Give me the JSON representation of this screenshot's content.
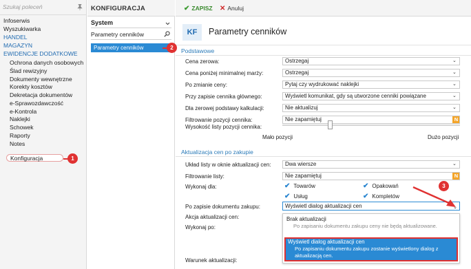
{
  "nav": {
    "search_placeholder": "Szukaj poleceń",
    "items": [
      {
        "label": "Infoserwis"
      },
      {
        "label": "Wyszukiwarka"
      },
      {
        "label": "HANDEL"
      },
      {
        "label": "MAGAZYN"
      },
      {
        "label": "EWIDENCJE DODATKOWE"
      },
      {
        "label": "Ochrona danych osobowych"
      },
      {
        "label": "Ślad rewizyjny"
      },
      {
        "label": "Dokumenty wewnętrzne"
      },
      {
        "label": "Korekty kosztów"
      },
      {
        "label": "Dekretacja dokumentów"
      },
      {
        "label": "e-Sprawozdawczość"
      },
      {
        "label": "e-Kontrola"
      },
      {
        "label": "Naklejki"
      },
      {
        "label": "Schowek"
      },
      {
        "label": "Raporty"
      },
      {
        "label": "Notes"
      },
      {
        "label": "Konfiguracja"
      }
    ]
  },
  "col2": {
    "header": "KONFIGURACJA",
    "system_label": "System",
    "search_value": "Parametry cenników",
    "selected_item": "Parametry cenników"
  },
  "toolbar": {
    "save_label": "ZAPISZ",
    "cancel_label": "Anuluj"
  },
  "page": {
    "badge": "KF",
    "title": "Parametry cenników"
  },
  "section1": {
    "title": "Podstawowe",
    "rows": [
      {
        "label": "Cena zerowa:",
        "value": "Ostrzegaj"
      },
      {
        "label": "Cena poniżej minimalnej marży:",
        "value": "Ostrzegaj"
      },
      {
        "label": "Po zmianie ceny:",
        "value": "Pytaj czy wydrukować naklejki"
      },
      {
        "label": "Przy zapisie cennika głównego:",
        "value": "Wyświetl komunikat, gdy są utworzone cenniki powiązane"
      },
      {
        "label": "Dla zerowej podstawy kalkulacji:",
        "value": "Nie aktualizuj"
      },
      {
        "label": "Filtrowanie pozycji cennika:",
        "value": "Nie zapamiętuj"
      }
    ],
    "height_label": "Wysokość listy pozycji cennika:",
    "slider_min": "Mało pozycji",
    "slider_max": "Dużo pozycji",
    "slider_level": 0.27
  },
  "section2": {
    "title": "Aktualizacja cen po zakupie",
    "layout_label": "Układ listy w oknie aktualizacji cen:",
    "layout_value": "Dwa wiersze",
    "filter_label": "Filtrowanie listy:",
    "filter_value": "Nie zapamiętuj",
    "perform_label": "Wykonaj dla:",
    "checks": [
      "Towarów",
      "Opakowań",
      "Usług",
      "Kompletów"
    ],
    "after_save_label": "Po zapisie dokumentu zakupu:",
    "after_save_value": "Wyświetl dialog aktualizacji cen",
    "action_label": "Akcja aktualizacji cen:",
    "perform_after_label": "Wykonaj po:",
    "condition_label": "Warunek aktualizacji:",
    "options": [
      {
        "title": "Brak aktualizacji",
        "desc": "Po zapisaniu dokumentu zakupu ceny nie będą aktualizowane."
      },
      {
        "title": "Wyświetl dialog aktualizacji cen",
        "desc": "Po zapisaniu dokumentu zakupu zostanie wyświetlony dialog z aktualizacją cen."
      }
    ]
  },
  "indicator_badge": "N",
  "callouts": [
    "1",
    "2",
    "3"
  ],
  "colors": {
    "accent": "#2a8ad4",
    "link_blue": "#1f6ab0",
    "save_green": "#3a8a2e",
    "cancel_red": "#d02a2a",
    "callout_red": "#e03232",
    "badge_orange": "#f4a52a"
  }
}
